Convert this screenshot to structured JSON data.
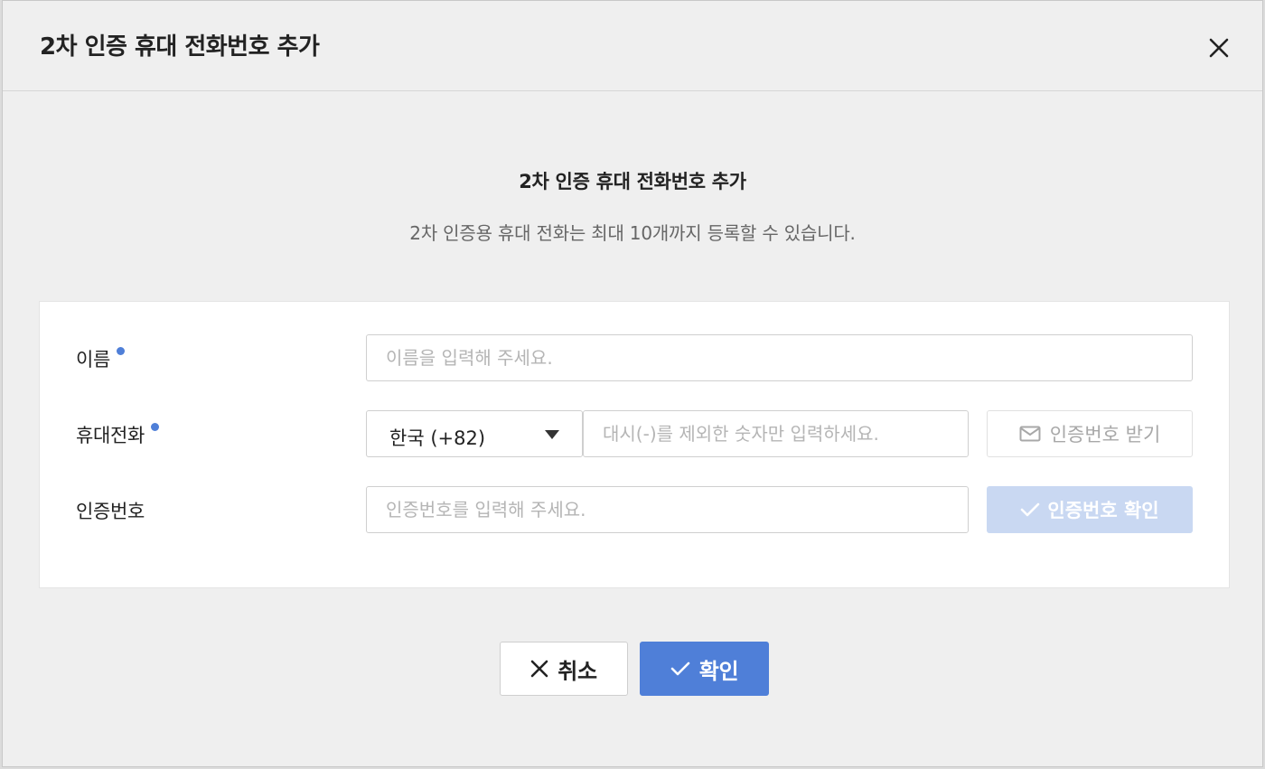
{
  "dialog": {
    "title": "2차 인증 휴대 전화번호 추가",
    "close_icon": "close-icon"
  },
  "intro": {
    "title": "2차 인증 휴대 전화번호 추가",
    "description": "2차 인증용 휴대 전화는 최대 10개까지 등록할 수 있습니다."
  },
  "form": {
    "name": {
      "label": "이름",
      "required": true,
      "value": "",
      "placeholder": "이름을 입력해 주세요."
    },
    "phone": {
      "label": "휴대전화",
      "required": true,
      "country_selected": "한국 (+82)",
      "value": "",
      "placeholder": "대시(-)를 제외한 숫자만 입력하세요.",
      "get_code_label": "인증번호 받기",
      "get_code_icon": "envelope-icon"
    },
    "code": {
      "label": "인증번호",
      "required": false,
      "value": "",
      "placeholder": "인증번호를 입력해 주세요.",
      "verify_label": "인증번호 확인",
      "verify_icon": "check-icon"
    }
  },
  "footer": {
    "cancel_label": "취소",
    "cancel_icon": "close-icon",
    "confirm_label": "확인",
    "confirm_icon": "check-icon"
  },
  "colors": {
    "accent": "#4f7fd8",
    "accent_disabled": "#c9d8f2",
    "dialog_bg": "#efefef",
    "panel_bg": "#ffffff"
  }
}
